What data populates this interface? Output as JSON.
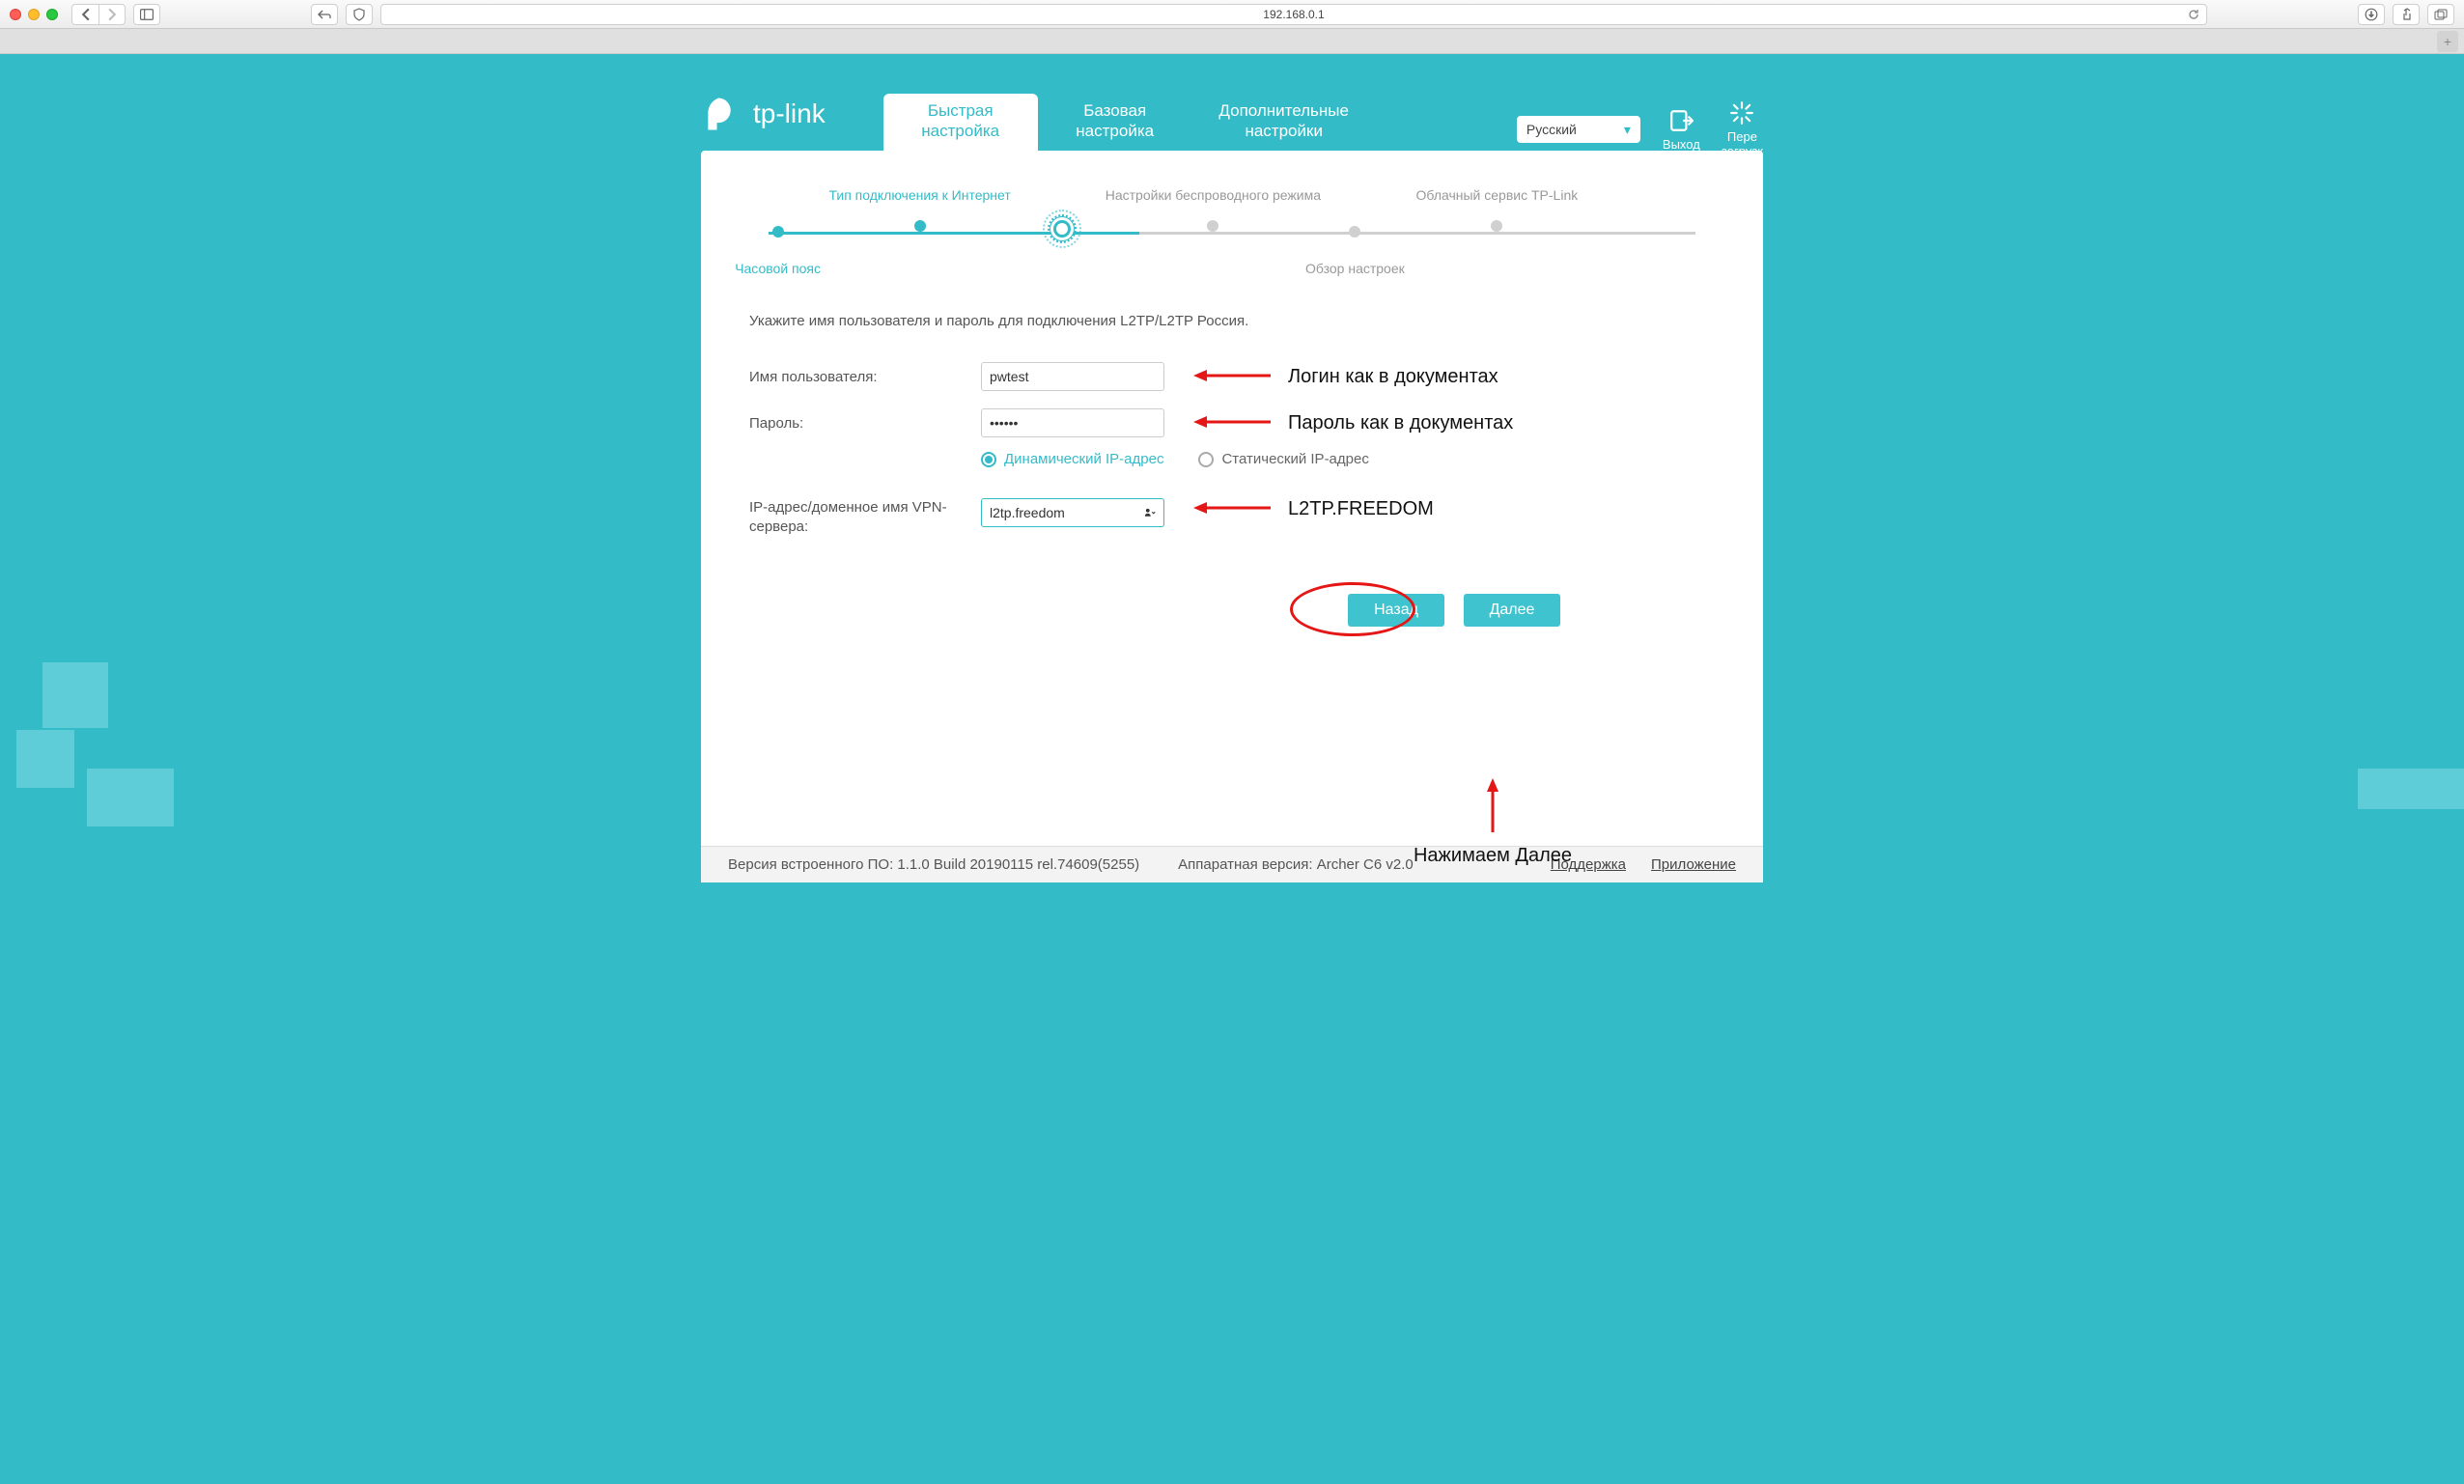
{
  "browser": {
    "url": "192.168.0.1"
  },
  "brand": "tp-link",
  "tabs": {
    "quick": "Быстрая\nнастройка",
    "basic": "Базовая\nнастройка",
    "advanced": "Дополнительные\nнастройки"
  },
  "lang": {
    "selected": "Русский"
  },
  "hdr_buttons": {
    "logout": "Выход",
    "reload": "Пере\nзагрузк"
  },
  "stepper": {
    "s1": "Часовой пояс",
    "s2": "Тип подключения к Интернет",
    "s3": "Настройки беспроводного режима",
    "s4": "Обзор настроек",
    "s5": "Облачный сервис TP-Link"
  },
  "instructions": "Укажите имя пользователя и пароль для подключения L2TP/L2TP Россия.",
  "form": {
    "username_label": "Имя пользователя:",
    "username_value": "pwtest",
    "password_label": "Пароль:",
    "password_value": "••••••",
    "radio_dynamic": "Динамический IP-адрес",
    "radio_static": "Статический IP-адрес",
    "ip_mode_selected": "dynamic",
    "vpn_label": "IP-адрес/доменное имя VPN-сервера:",
    "vpn_value": "l2tp.freedom"
  },
  "annotations": {
    "login": "Логин как в документах",
    "pass": "Пароль как в документах",
    "vpn": "L2TP.FREEDOM",
    "next_caption": "Нажимаем Далее"
  },
  "buttons": {
    "back": "Назад",
    "next": "Далее"
  },
  "footer": {
    "fw": "Версия встроенного ПО: 1.1.0 Build 20190115 rel.74609(5255)",
    "hw": "Аппаратная версия: Archer C6 v2.0",
    "support": "Поддержка",
    "app": "Приложение"
  }
}
